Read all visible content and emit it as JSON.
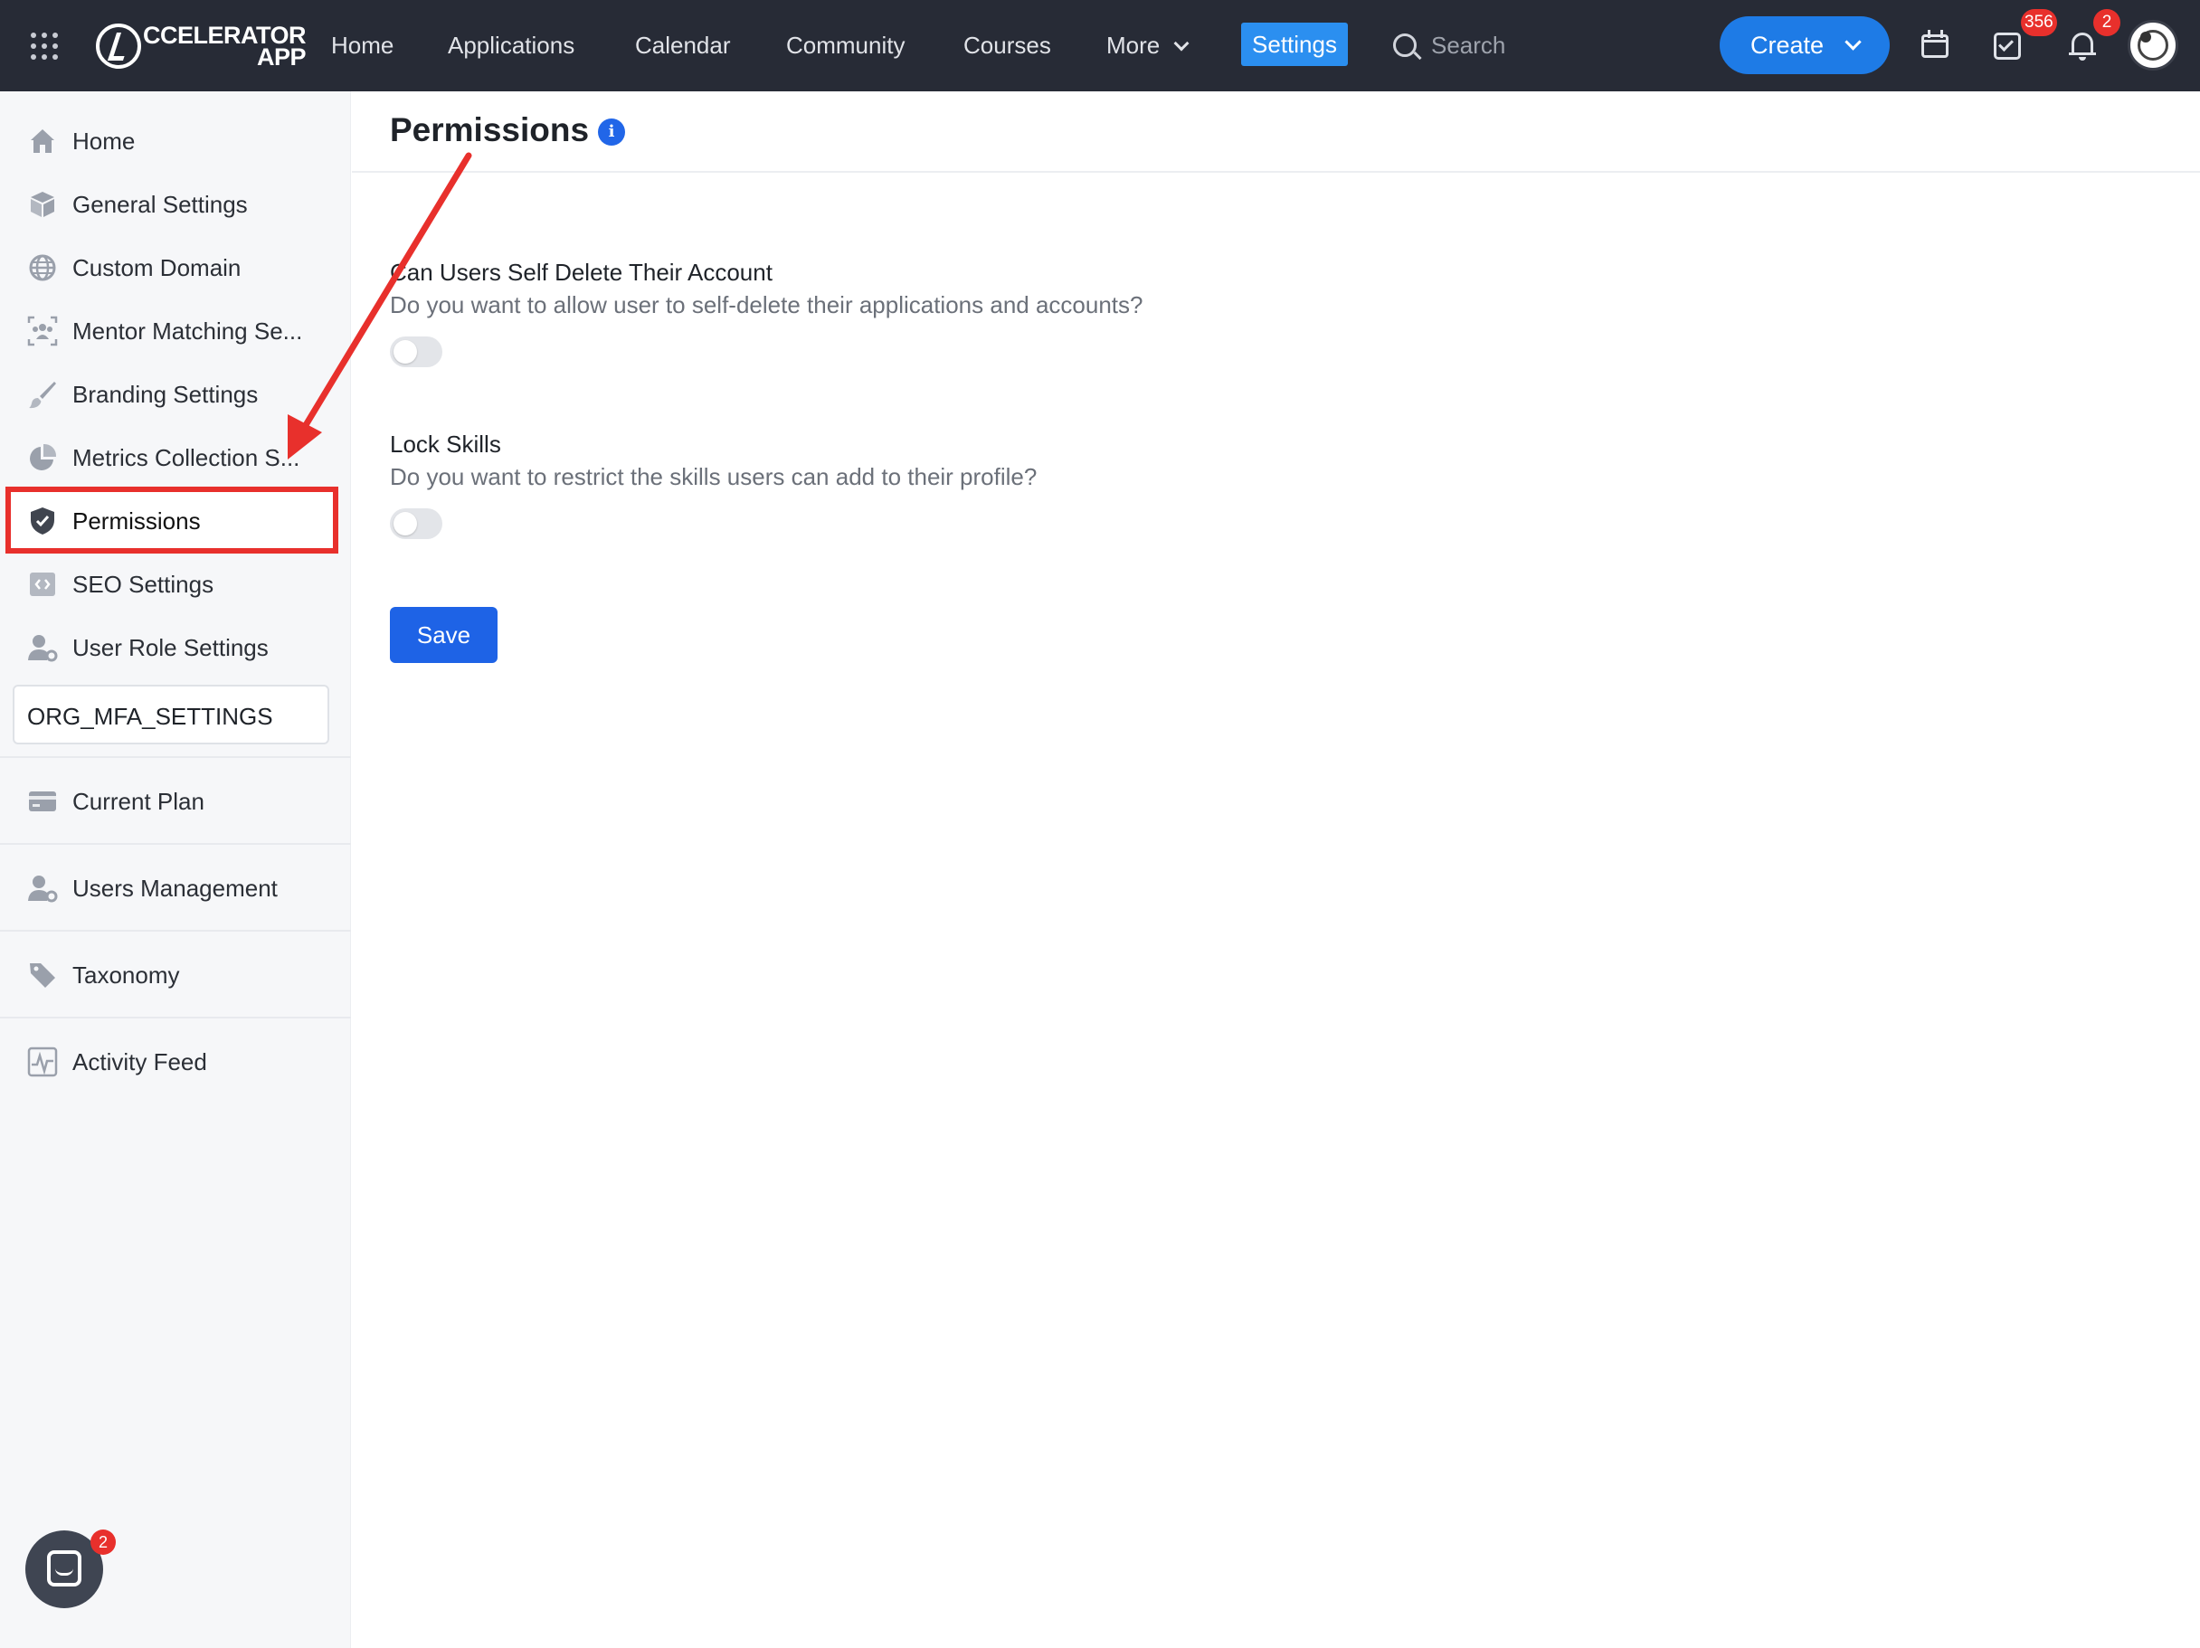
{
  "topnav": {
    "logo_line1": "CCELERATOR",
    "logo_line2": "APP",
    "links": [
      "Home",
      "Applications",
      "Calendar",
      "Community",
      "Courses",
      "More"
    ],
    "settings_label": "Settings",
    "search_placeholder": "Search",
    "create_label": "Create",
    "tasks_badge": "356",
    "notifications_badge": "2"
  },
  "sidebar": {
    "items": [
      {
        "label": "Home",
        "icon": "home-icon"
      },
      {
        "label": "General Settings",
        "icon": "cube-icon"
      },
      {
        "label": "Custom Domain",
        "icon": "globe-icon"
      },
      {
        "label": "Mentor Matching Se...",
        "icon": "users-frame-icon"
      },
      {
        "label": "Branding Settings",
        "icon": "brush-icon"
      },
      {
        "label": "Metrics Collection S...",
        "icon": "pie-chart-icon"
      },
      {
        "label": "Permissions",
        "icon": "shield-icon"
      },
      {
        "label": "SEO Settings",
        "icon": "code-icon"
      },
      {
        "label": "User Role Settings",
        "icon": "user-gear-icon"
      }
    ],
    "org_mfa": "ORG_MFA_SETTINGS",
    "sections": [
      {
        "label": "Current Plan",
        "icon": "credit-card-icon"
      },
      {
        "label": "Users Management",
        "icon": "user-gear-icon"
      },
      {
        "label": "Taxonomy",
        "icon": "tag-icon"
      },
      {
        "label": "Activity Feed",
        "icon": "activity-icon"
      }
    ],
    "chat_badge": "2"
  },
  "main": {
    "title": "Permissions",
    "permissions": [
      {
        "title": "Can Users Self Delete Their Account",
        "description": "Do you want to allow user to self-delete their applications and accounts?",
        "enabled": false
      },
      {
        "title": "Lock Skills",
        "description": "Do you want to restrict the skills users can add to their profile?",
        "enabled": false
      }
    ],
    "save_label": "Save"
  },
  "colors": {
    "nav_bg": "#272b36",
    "accent": "#1e7be6",
    "settings_tab": "#2b8ff0",
    "save_button": "#1e63e6",
    "annotation_red": "#e8302c",
    "badge_red": "#e8302c"
  }
}
